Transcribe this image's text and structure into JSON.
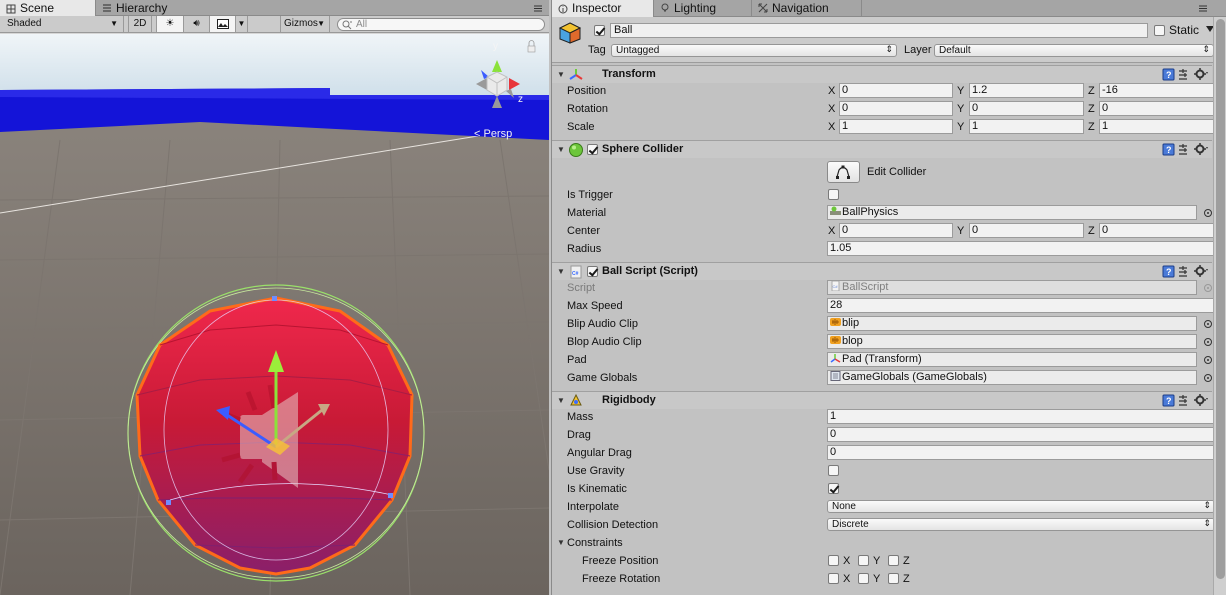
{
  "scene": {
    "tabs": [
      {
        "label": "Scene"
      },
      {
        "label": "Hierarchy"
      }
    ],
    "toolbar": {
      "draw_mode": "Shaded",
      "two_d": "2D",
      "gizmos": "Gizmos",
      "search_placeholder": "All"
    },
    "persp_label": "< Persp",
    "axis_y": "y",
    "axis_z": "z"
  },
  "inspector": {
    "tabs": [
      {
        "label": "Inspector"
      },
      {
        "label": "Lighting"
      },
      {
        "label": "Navigation"
      }
    ],
    "object": {
      "name": "Ball",
      "active": true,
      "static_label": "Static",
      "static": false,
      "tag_label": "Tag",
      "tag": "Untagged",
      "layer_label": "Layer",
      "layer": "Default"
    },
    "transform": {
      "title": "Transform",
      "rows": [
        {
          "label": "Position",
          "x": "0",
          "y": "1.2",
          "z": "-16"
        },
        {
          "label": "Rotation",
          "x": "0",
          "y": "0",
          "z": "0"
        },
        {
          "label": "Scale",
          "x": "1",
          "y": "1",
          "z": "1"
        }
      ]
    },
    "axes": {
      "x": "X",
      "y": "Y",
      "z": "Z"
    },
    "sphere_collider": {
      "title": "Sphere Collider",
      "edit_collider": "Edit Collider",
      "is_trigger_label": "Is Trigger",
      "is_trigger": false,
      "material_label": "Material",
      "material": "BallPhysics",
      "center_label": "Center",
      "center": {
        "x": "0",
        "y": "0",
        "z": "0"
      },
      "radius_label": "Radius",
      "radius": "1.05"
    },
    "ball_script": {
      "title": "Ball Script (Script)",
      "script_label": "Script",
      "script": "BallScript",
      "max_speed_label": "Max Speed",
      "max_speed": "28",
      "blip_label": "Blip Audio Clip",
      "blip": "blip",
      "blop_label": "Blop Audio Clip",
      "blop": "blop",
      "pad_label": "Pad",
      "pad": "Pad (Transform)",
      "globals_label": "Game Globals",
      "globals": "GameGlobals (GameGlobals)"
    },
    "rigidbody": {
      "title": "Rigidbody",
      "mass_label": "Mass",
      "mass": "1",
      "drag_label": "Drag",
      "drag": "0",
      "angular_drag_label": "Angular Drag",
      "angular_drag": "0",
      "use_gravity_label": "Use Gravity",
      "use_gravity": false,
      "is_kinematic_label": "Is Kinematic",
      "is_kinematic": true,
      "interpolate_label": "Interpolate",
      "interpolate": "None",
      "collision_label": "Collision Detection",
      "collision": "Discrete",
      "constraints_label": "Constraints",
      "freeze_position_label": "Freeze Position",
      "freeze_rotation_label": "Freeze Rotation",
      "freeze_axes": {
        "x": "X",
        "y": "Y",
        "z": "Z"
      }
    }
  },
  "colors": {
    "wall": "#1414d8",
    "floor": "#6d6660",
    "sky": "#d8e6f0",
    "ball": "#d8203c",
    "ball_outline": "#ff6a1a",
    "collider": "#8fdc5a"
  }
}
